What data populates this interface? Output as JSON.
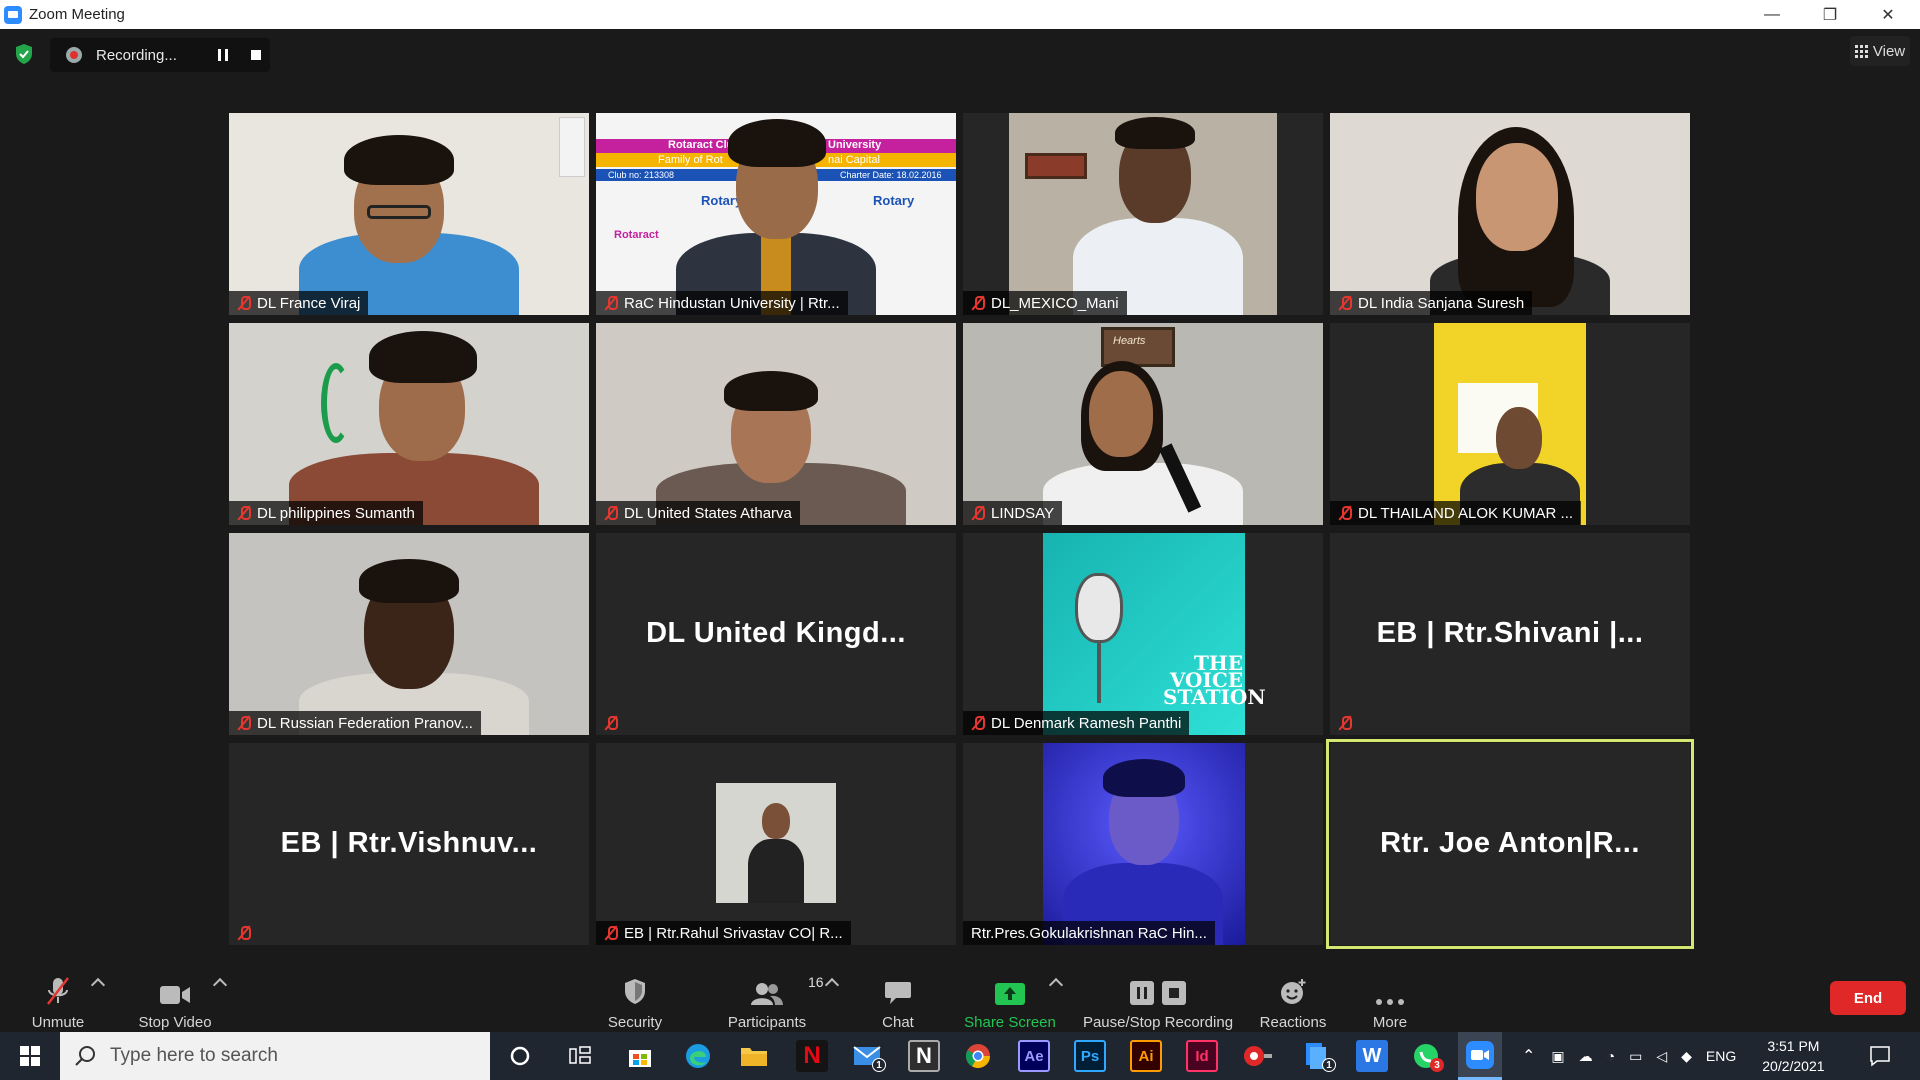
{
  "window": {
    "title": "Zoom Meeting",
    "minimize": "—",
    "restore": "❐",
    "close": "✕"
  },
  "recording": {
    "status": "Recording..."
  },
  "view_button": {
    "label": "View"
  },
  "participants": [
    {
      "name": "DL France Viraj",
      "muted": true,
      "type": "video"
    },
    {
      "name": "RaC Hindustan University | Rtr...",
      "muted": true,
      "type": "video"
    },
    {
      "name": "DL_MEXICO_Mani",
      "muted": true,
      "type": "video"
    },
    {
      "name": "DL India Sanjana Suresh",
      "muted": true,
      "type": "video"
    },
    {
      "name": "DL philippines Sumanth",
      "muted": true,
      "type": "video"
    },
    {
      "name": "DL United States Atharva",
      "muted": true,
      "type": "video"
    },
    {
      "name": "LINDSAY",
      "muted": true,
      "type": "video"
    },
    {
      "name": "DL THAILAND ALOK KUMAR ...",
      "muted": true,
      "type": "video"
    },
    {
      "name": "DL Russian Federation Pranov...",
      "muted": true,
      "type": "video"
    },
    {
      "name": "",
      "display": "DL United Kingd...",
      "muted": true,
      "type": "name"
    },
    {
      "name": "DL Denmark Ramesh Panthi",
      "muted": true,
      "type": "image"
    },
    {
      "name": "",
      "display": "EB | Rtr.Shivani |...",
      "muted": true,
      "type": "name"
    },
    {
      "name": "",
      "display": "EB | Rtr.Vishnuv...",
      "muted": true,
      "type": "name"
    },
    {
      "name": "EB | Rtr.Rahul Srivastav CO| R...",
      "muted": true,
      "type": "image"
    },
    {
      "name": "Rtr.Pres.Gokulakrishnan RaC Hin...",
      "muted": false,
      "type": "video"
    },
    {
      "name": "",
      "display": "Rtr. Joe Anton|R...",
      "muted": false,
      "type": "name",
      "active_speaker": true
    }
  ],
  "banner_text": {
    "club": "Rotaract Club",
    "university": "University",
    "family": "Family of Rot",
    "capital": "nai Capital",
    "club_no": "Club no: 213308",
    "charter": "Charter Date: 18.02.2016",
    "rotary": "Rotary",
    "rotaract": "Rotaract"
  },
  "voice_station": {
    "line1": "THE",
    "line2": "VOICE",
    "line3": "STATION"
  },
  "poster_text": "Hearts",
  "toolbar": {
    "unmute": "Unmute",
    "stop_video": "Stop Video",
    "security": "Security",
    "participants": "Participants",
    "participant_count": "16",
    "chat": "Chat",
    "share_screen": "Share Screen",
    "pause_stop_recording": "Pause/Stop Recording",
    "reactions": "Reactions",
    "more": "More",
    "end": "End"
  },
  "taskbar": {
    "search_placeholder": "Type here to search",
    "mail_badge": "1",
    "files_badge": "1",
    "whatsapp_badge": "3",
    "language": "ENG",
    "time": "3:51 PM",
    "date": "20/2/2021",
    "apps": {
      "netflix": "N",
      "notion": "N",
      "after_effects": "Ae",
      "photoshop": "Ps",
      "illustrator": "Ai",
      "indesign": "Id",
      "word": "W"
    }
  },
  "colors": {
    "accent_blue": "#2d8cff",
    "mute_red": "#e5372f",
    "share_green": "#23c552",
    "end_red": "#e02828",
    "active_border": "#d4e770"
  }
}
